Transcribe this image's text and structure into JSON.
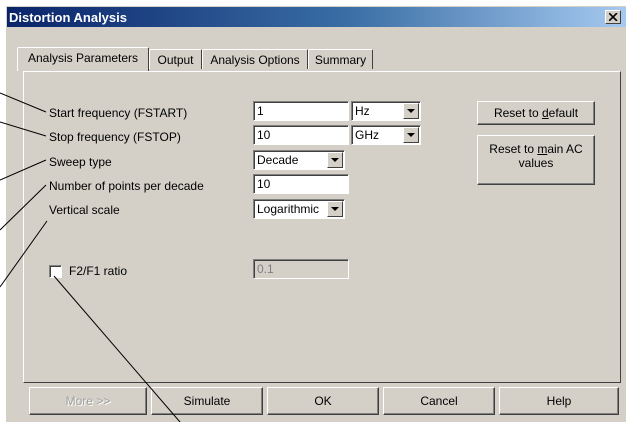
{
  "window": {
    "title": "Distortion Analysis",
    "close_symbol": "×"
  },
  "tabs": [
    {
      "label": "Analysis Parameters",
      "active": true
    },
    {
      "label": "Output",
      "active": false
    },
    {
      "label": "Analysis Options",
      "active": false
    },
    {
      "label": "Summary",
      "active": false
    }
  ],
  "params": {
    "start_frequency": {
      "label": "Start frequency (FSTART)",
      "value": "1",
      "unit": "Hz"
    },
    "stop_frequency": {
      "label": "Stop frequency (FSTOP)",
      "value": "10",
      "unit": "GHz"
    },
    "sweep_type": {
      "label": "Sweep type",
      "value": "Decade"
    },
    "points_per_decade": {
      "label": "Number of points per decade",
      "value": "10"
    },
    "vertical_scale": {
      "label": "Vertical scale",
      "value": "Logarithmic"
    },
    "f2f1_ratio": {
      "label": "F2/F1 ratio",
      "checked": false,
      "value": "0.1"
    }
  },
  "side_buttons": {
    "reset_default": {
      "prefix": "Reset to ",
      "underlined": "d",
      "suffix": "efault"
    },
    "reset_main_ac": {
      "line1_prefix": "Reset to ",
      "line1_underlined": "m",
      "line1_suffix": "ain AC",
      "line2": "values"
    }
  },
  "footer": {
    "more": "More >>",
    "simulate": "Simulate",
    "ok": "OK",
    "cancel": "Cancel",
    "help": "Help"
  },
  "icons": {
    "close": "close-icon",
    "dropdown": "chevron-down-icon"
  }
}
